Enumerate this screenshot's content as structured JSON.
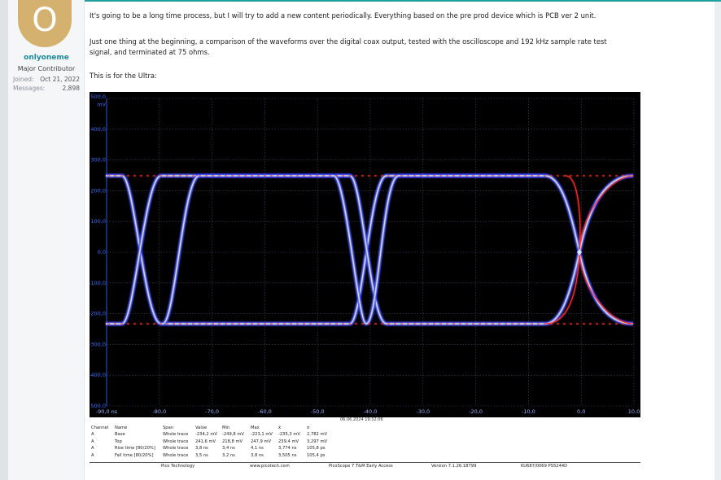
{
  "post": {
    "username": "onlyoneme",
    "user_title": "Major Contributor",
    "joined_label": "Joined:",
    "joined_value": "Oct 21, 2022",
    "messages_label": "Messages:",
    "messages_value": "2,898",
    "avatar_letter": "O",
    "paragraphs": [
      "It's going to be a long time process, but I will try to add a new content periodically. Everything based on the pre prod device which is PCB ver 2 unit.",
      "Just one thing at the beginning, a comparison of the waveforms over the digital coax output, tested with the oscilloscope and 192 kHz sample rate test",
      "signal, and terminated at 75 ohms.",
      "This is for the Ultra:"
    ]
  },
  "scope": {
    "y_ticks": [
      "500,0",
      "400,0",
      "300,0",
      "200,0",
      "100,0",
      "0,0",
      "-100,0",
      "-200,0",
      "-300,0",
      "-400,0",
      "500,0"
    ],
    "y_unit": "mV",
    "x_ticks": [
      "-90,0 ns",
      "-80,0",
      "-70,0",
      "-60,0",
      "-50,0",
      "-40,0",
      "-30,0",
      "-20,0",
      "-10,0",
      "0,0",
      "10,0"
    ],
    "timestamp": "06.06.2024 19:32:06",
    "headers": [
      "Channel",
      "Name",
      "Span",
      "Value",
      "Min",
      "Max",
      "x̄",
      "σ"
    ],
    "rows": [
      [
        "A",
        "Base",
        "Whole trace",
        "-234,2 mV",
        "-249,8 mV",
        "-223,1 mV",
        "-235,3 mV",
        "2,782 mV"
      ],
      [
        "A",
        "Top",
        "Whole trace",
        "241,6 mV",
        "218,8 mV",
        "247,9 mV",
        "239,4 mV",
        "3,297 mV"
      ],
      [
        "A",
        "Rise time [80/20%]",
        "Whole trace",
        "3,8 ns",
        "3,4 ns",
        "4,1 ns",
        "3,774 ns",
        "105,8 ps"
      ],
      [
        "A",
        "Fall time [80/20%]",
        "Whole trace",
        "3,5 ns",
        "3,2 ns",
        "3,8 ns",
        "3,505 ns",
        "105,4 ps"
      ]
    ],
    "footer": [
      "Pico Technology",
      "www.picotech.com",
      "PicoScope 7 T&M Early Access",
      "Version 7.1.26.18799",
      "KU687/0069 PS5244D"
    ]
  },
  "colors": {
    "accent": "#20a0a0",
    "username": "#1f8a9a",
    "avatar": "#d4b16f",
    "trace_blue": "#3040ff",
    "trace_red": "#ff3030"
  }
}
